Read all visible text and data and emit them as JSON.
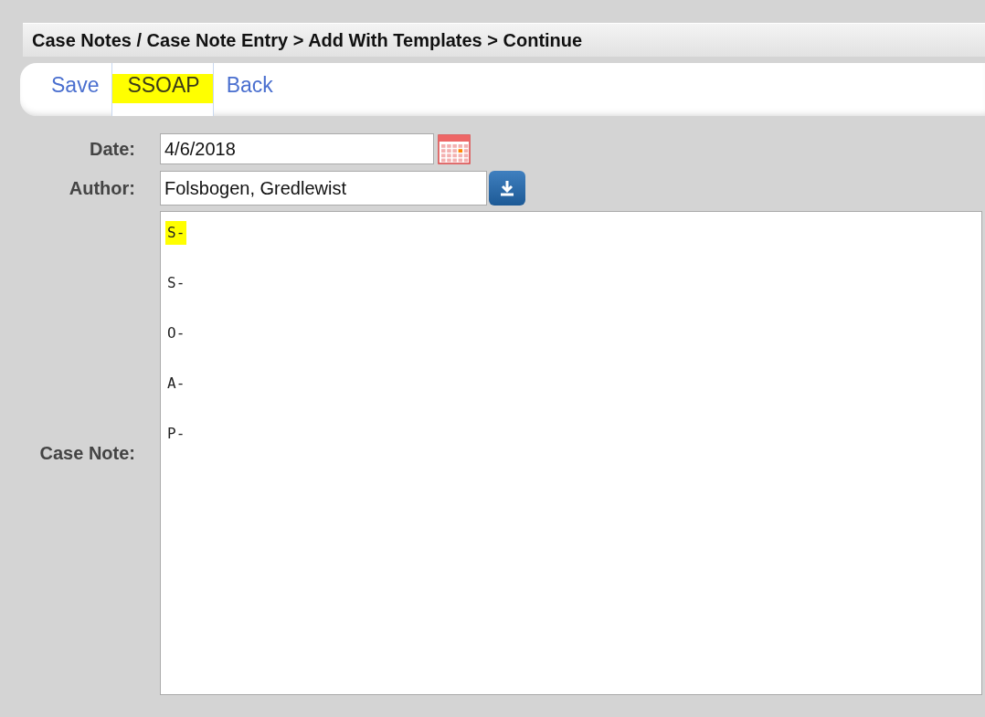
{
  "breadcrumb": "Case Notes / Case Note Entry > Add With Templates > Continue",
  "tabs": [
    {
      "label": "Save",
      "selected": false,
      "highlighted": false
    },
    {
      "label": "SSOAP",
      "selected": true,
      "highlighted": true
    },
    {
      "label": "Back",
      "selected": false,
      "highlighted": false
    }
  ],
  "form": {
    "date": {
      "label": "Date:",
      "value": "4/6/2018"
    },
    "author": {
      "label": "Author:",
      "value": "Folsbogen, Gredlewist"
    },
    "case_note": {
      "label": "Case Note:",
      "lines": [
        {
          "text": "S-",
          "highlighted": true
        },
        {
          "text": "S-",
          "highlighted": false
        },
        {
          "text": "O-",
          "highlighted": false
        },
        {
          "text": "A-",
          "highlighted": false
        },
        {
          "text": "P-",
          "highlighted": false
        }
      ]
    }
  }
}
